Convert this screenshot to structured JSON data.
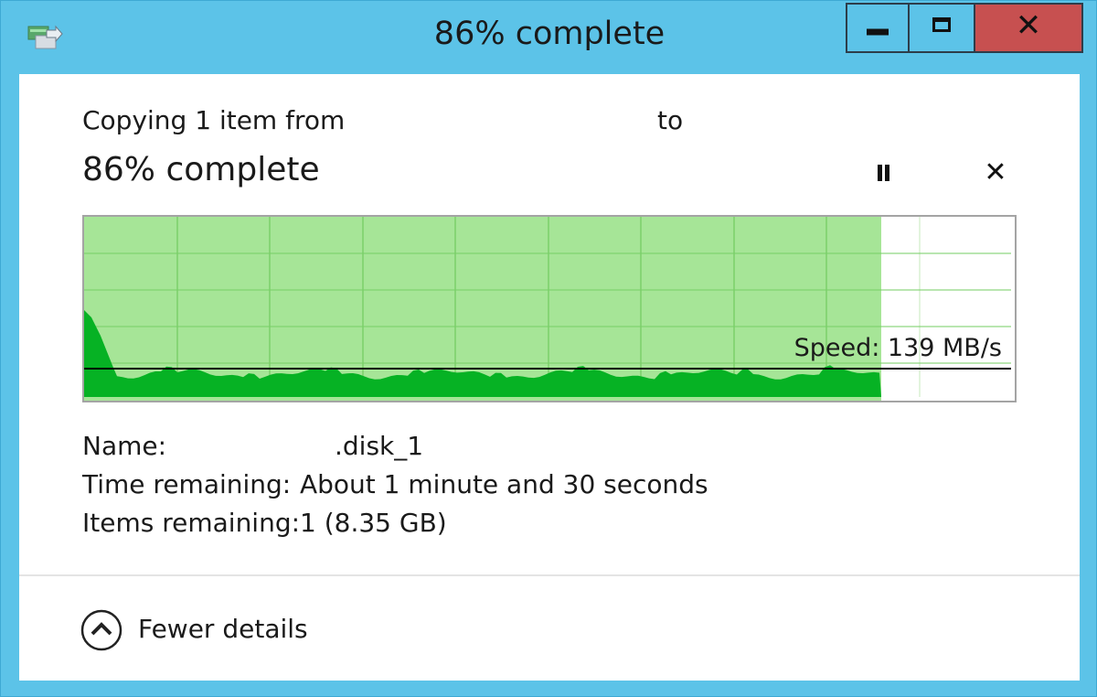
{
  "window": {
    "title": "86% complete",
    "icon": "file-copy-icon",
    "controls": {
      "minimize": "minimize-icon",
      "maximize": "maximize-icon",
      "close": "✕"
    }
  },
  "header": {
    "copying_prefix": "Copying 1 item from",
    "copying_to": "to",
    "progress_text": "86% complete",
    "pause_icon": "pause-icon",
    "cancel_icon": "✕"
  },
  "graph": {
    "progress": 0.86,
    "speed_label": "Speed: 139 MB/s",
    "speed_mb_s": 139,
    "colors": {
      "complete_fill": "#a6e597",
      "throughput_fill": "#06b224",
      "grid": "#7bd06a",
      "speed_line": "#000000"
    }
  },
  "details": {
    "name_label": "Name:",
    "name_value": ".disk_1",
    "time_label": "Time remaining:",
    "time_value": "About 1 minute and 30 seconds",
    "items_label": "Items remaining:",
    "items_value": "1 (8.35 GB)"
  },
  "footer": {
    "toggle_label": "Fewer details",
    "toggle_icon": "chevron-up-circle-icon"
  }
}
